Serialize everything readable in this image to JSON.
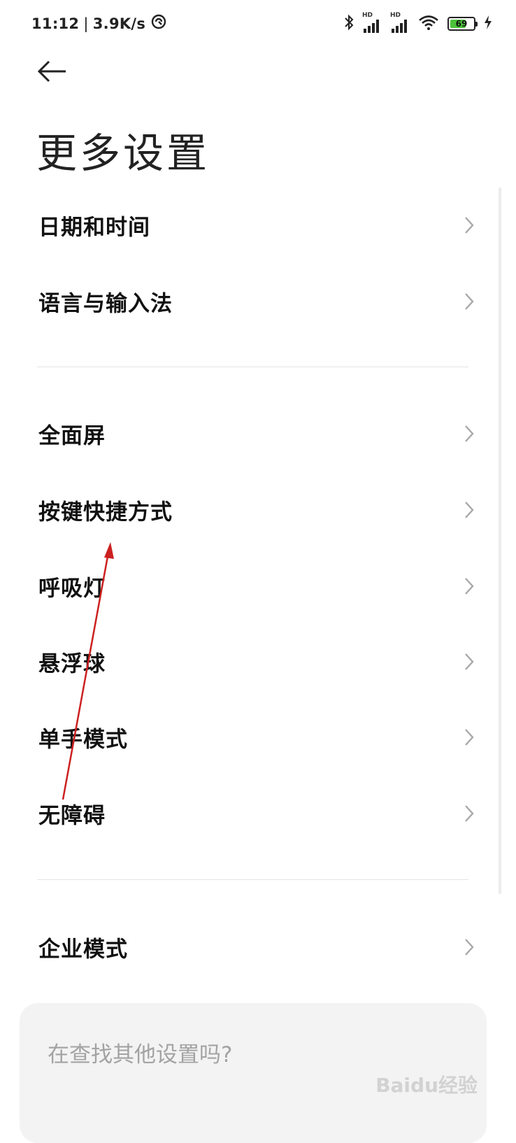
{
  "status_bar": {
    "time": "11:12",
    "separator": "|",
    "net_speed": "3.9K/s",
    "network_type": "HD",
    "battery_level": "69",
    "icons": [
      "data-saver-icon",
      "bluetooth-icon",
      "signal-icon",
      "signal-icon",
      "wifi-icon",
      "battery-icon",
      "charging-icon"
    ]
  },
  "header": {
    "back_icon": "back-arrow-icon",
    "title": "更多设置"
  },
  "sections": [
    {
      "items": [
        {
          "label": "日期和时间"
        },
        {
          "label": "语言与输入法"
        }
      ]
    },
    {
      "items": [
        {
          "label": "全面屏"
        },
        {
          "label": "按键快捷方式"
        },
        {
          "label": "呼吸灯"
        },
        {
          "label": "悬浮球"
        },
        {
          "label": "单手模式"
        },
        {
          "label": "无障碍"
        }
      ]
    },
    {
      "items": [
        {
          "label": "企业模式"
        }
      ]
    }
  ],
  "search_card": {
    "prompt": "在查找其他设置吗?"
  },
  "watermark": "Baidu经验",
  "colors": {
    "accent_battery": "#4cc23a",
    "annotation_arrow": "#cc2020",
    "chevron": "#a8a8a8"
  }
}
